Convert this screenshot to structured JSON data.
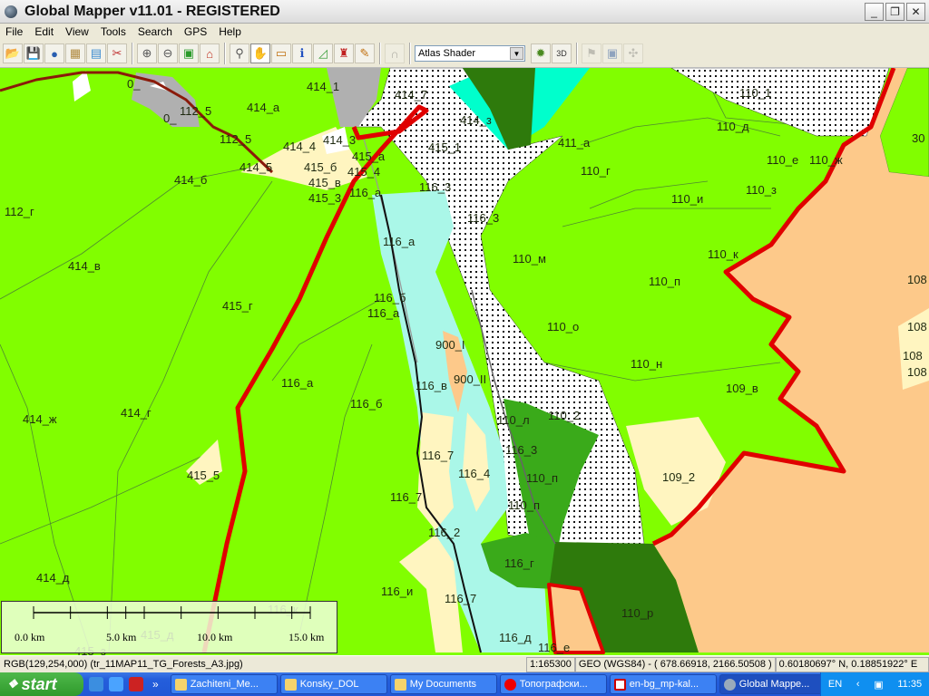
{
  "window": {
    "title": "Global Mapper v11.01 - REGISTERED",
    "buttons": [
      "_",
      "❐",
      "✕"
    ]
  },
  "menu": [
    "File",
    "Edit",
    "View",
    "Tools",
    "Search",
    "GPS",
    "Help"
  ],
  "toolbar": {
    "group1": [
      "open-icon",
      "save-icon",
      "globe-icon",
      "config-icon",
      "layers-icon",
      "tools-icon"
    ],
    "group2": [
      "zoom-in-icon",
      "zoom-out-icon",
      "full-view-icon",
      "home-icon"
    ],
    "group3": [
      "zoom-tool-icon",
      "pan-hand-icon",
      "measure-icon",
      "feature-info-icon",
      "digitizer-icon",
      "path-profile-icon",
      "edit-icon"
    ],
    "group4": [
      "3d-view-disabled-icon"
    ],
    "shader": "Atlas Shader",
    "group5": [
      "shader-settings-icon",
      "3d-view-icon"
    ],
    "group6": [
      "flag-icon",
      "display-icon",
      "gps-icon"
    ],
    "active_tool": "pan-hand-icon"
  },
  "map": {
    "colors": {
      "forest": "#81fe00",
      "shrub": "#fff5c0",
      "water_pale": "#aaf7e8",
      "cyan": "#00ffcc",
      "dark_green": "#2e7a0c",
      "mid_green": "#3aaa1a",
      "orange": "#fdc98a",
      "gray": "#b0b0b0",
      "boundary": "#e00000",
      "road": "#8a1a0a"
    },
    "labels": [
      "0_",
      "0_",
      "112_5",
      "414_а",
      "414_1",
      "414_7",
      "414_з",
      "112_5",
      "414_4",
      "414_3",
      "415_а",
      "415_1",
      "411_а",
      "414_5",
      "415_б",
      "415_4",
      "414_б",
      "415_в",
      "116_а",
      "116_3",
      "415_3",
      "112_г",
      "116_3",
      "116_а",
      "414_в",
      "415_г",
      "116_б",
      "116_а",
      "116_а",
      "116_б",
      "116_в",
      "900_I",
      "900_II",
      "414_ж",
      "414_г",
      "415_5",
      "116_7",
      "116_4",
      "116_7",
      "116_2",
      "116_и",
      "116_7",
      "414_д",
      "116_д",
      "116_е",
      "116_к",
      "415_д",
      "415_з",
      "110_1",
      "110_д",
      "110_г",
      "110_е",
      "110_ж",
      "110_и",
      "110_з",
      "110_к",
      "110_м",
      "110_п",
      "110_о",
      "110_н",
      "109_в",
      "110_л",
      "110_2",
      "116_3",
      "110_п",
      "110_п",
      "109_2",
      "116_г",
      "110_р",
      "30",
      "108",
      "108",
      "108",
      "108"
    ],
    "scale_bar": [
      "0.0 km",
      "5.0 km",
      "10.0 km",
      "15.0 km"
    ]
  },
  "status": {
    "pixel": "RGB(129,254,000) (tr_11MAP11_TG_Forests_A3.jpg)",
    "scale": "1:165300",
    "projection": "GEO (WGS84) - ( 678.66918, 2166.50508 )",
    "coords": "0.60180697° N, 0.18851922° E"
  },
  "taskbar": {
    "start": "start",
    "more": "»",
    "tasks": [
      "Zachiteni_Me...",
      "Konsky_DOL",
      "My Documents",
      "Топографски...",
      "en-bg_mp-kal...",
      "Global Mappe..."
    ],
    "lang": "EN",
    "clock": "11:35"
  }
}
